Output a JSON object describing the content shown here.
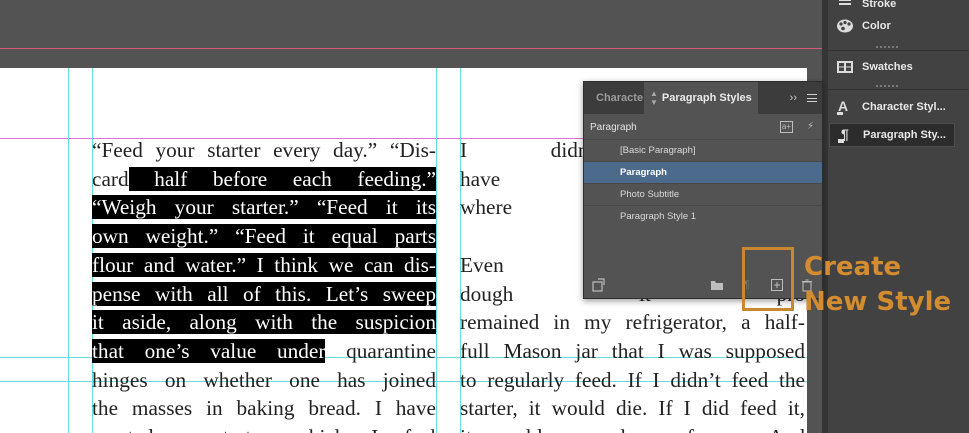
{
  "document": {
    "column1_lines": [
      {
        "before": "“Feed your starter every day.” “Dis-",
        "highlight": "",
        "after": ""
      },
      {
        "before": "card",
        "highlight": " half before each feeding.”",
        "after": ""
      },
      {
        "before": "",
        "highlight": "“Weigh your starter.” “Feed it its",
        "after": ""
      },
      {
        "before": "",
        "highlight": "own weight.” “Feed it equal parts",
        "after": ""
      },
      {
        "before": "",
        "highlight": "flour and water.” I think we can dis-",
        "after": ""
      },
      {
        "before": "",
        "highlight": "pense with all of this. Let’s sweep",
        "after": ""
      },
      {
        "before": "",
        "highlight": "it aside, along with the suspicion",
        "after": ""
      },
      {
        "before": "",
        "highlight": "that one’s value under",
        "after": " quarantine"
      },
      {
        "before": "hinges on whether one has joined",
        "highlight": "",
        "after": ""
      },
      {
        "before": "the masses in baking bread. I have",
        "highlight": "",
        "after": ""
      },
      {
        "before": "wanted a starter which I feel",
        "highlight": "",
        "after": ""
      }
    ],
    "column2_lines": [
      "I didn’t get o",
      "have the “bre",
      "where in the",
      "",
      "Even after I",
      "dough it pro",
      "remained in my refrigerator, a half-",
      "full Mason jar that I was supposed",
      "to regularly feed. If I didn’t feed the",
      "starter, it would die. If I did feed it,",
      "it would grow larger forever. And"
    ]
  },
  "dock": {
    "items": [
      {
        "label": "Stroke",
        "icon": "stroke-icon"
      },
      {
        "label": "Color",
        "icon": "color-palette-icon"
      },
      {
        "label": "Swatches",
        "icon": "swatches-icon"
      },
      {
        "label": "Character Styl...",
        "icon": "character-styles-icon"
      },
      {
        "label": "Paragraph Sty...",
        "icon": "paragraph-styles-icon"
      }
    ]
  },
  "panel": {
    "tab_inactive": "Characte",
    "tab_active": "Paragraph Styles",
    "expand_label": "››",
    "current_style": "Paragraph",
    "styles": [
      {
        "label": "[Basic Paragraph]",
        "selected": false
      },
      {
        "label": "Paragraph",
        "selected": true
      },
      {
        "label": "Photo Subtitle",
        "selected": false
      },
      {
        "label": "Paragraph Style 1",
        "selected": false
      }
    ]
  },
  "callout": {
    "line1": "Create",
    "line2": "New Style",
    "color": "#d38c2f"
  },
  "colors": {
    "selection": "#4b6a8c",
    "guide": "#66dede",
    "margin": "#e46fd2"
  }
}
